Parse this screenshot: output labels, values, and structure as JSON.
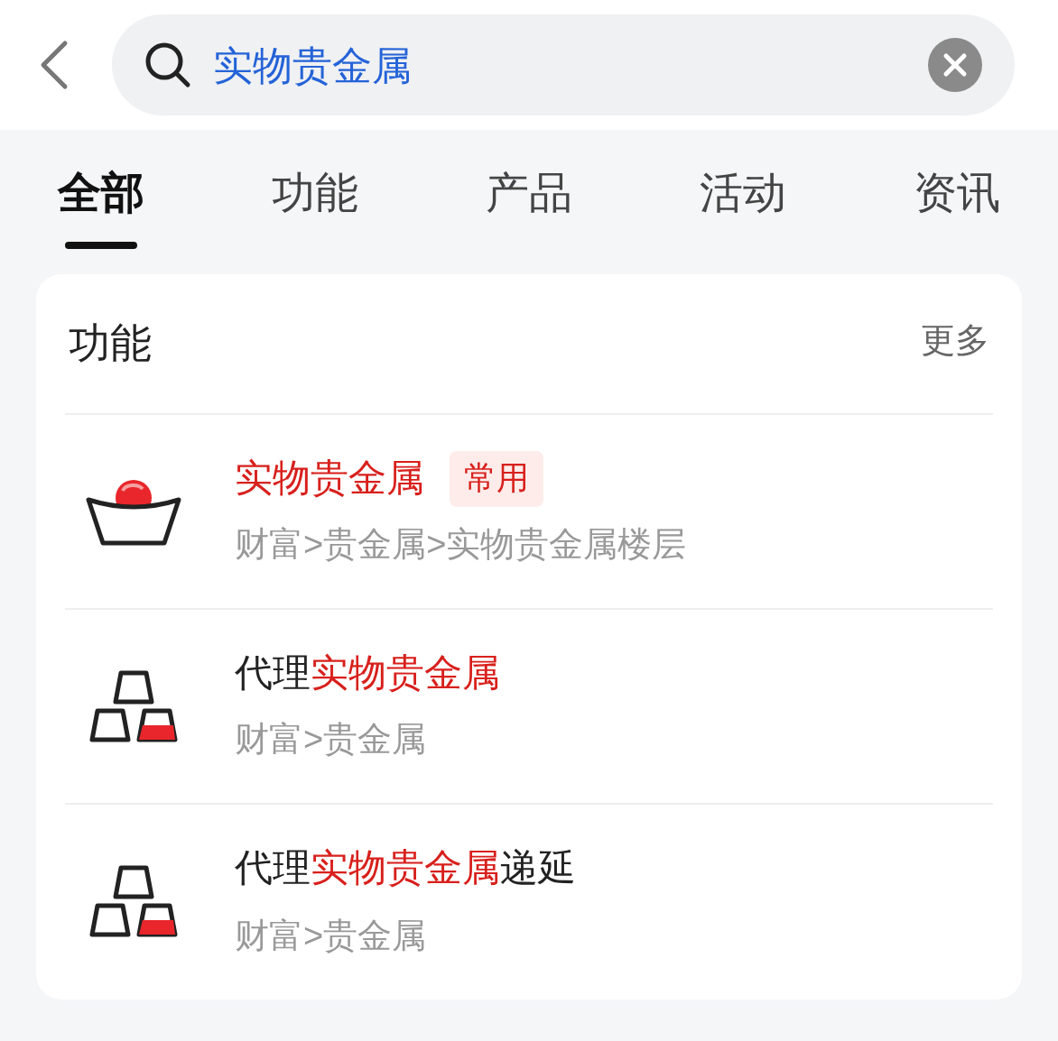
{
  "search": {
    "value": "实物贵金属"
  },
  "tabs": [
    {
      "label": "全部",
      "selected": true
    },
    {
      "label": "功能",
      "selected": false
    },
    {
      "label": "产品",
      "selected": false
    },
    {
      "label": "活动",
      "selected": false
    },
    {
      "label": "资讯",
      "selected": false
    }
  ],
  "section": {
    "title": "功能",
    "more": "更多"
  },
  "results": [
    {
      "kind": "ingot",
      "title": [
        {
          "text": "实物贵金属",
          "highlight": true
        }
      ],
      "tag": "常用",
      "path": "财富>贵金属>实物贵金属楼层"
    },
    {
      "kind": "bars",
      "title": [
        {
          "text": "代理",
          "highlight": false
        },
        {
          "text": "实物贵金属",
          "highlight": true
        }
      ],
      "path": "财富>贵金属"
    },
    {
      "kind": "bars",
      "title": [
        {
          "text": "代理",
          "highlight": false
        },
        {
          "text": "实物贵金属",
          "highlight": true
        },
        {
          "text": "递延",
          "highlight": false
        }
      ],
      "path": "财富>贵金属"
    }
  ]
}
